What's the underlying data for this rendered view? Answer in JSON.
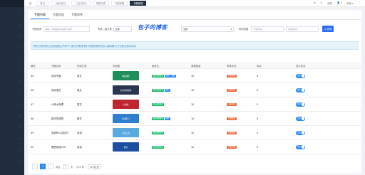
{
  "sidebar": {
    "arrows": [
      "›",
      "›",
      "›",
      "›",
      "›",
      "›",
      "›",
      "›",
      "›",
      "›",
      "›",
      "›",
      "›",
      "›"
    ]
  },
  "topbar": {
    "tabs": [
      "首",
      "首页",
      "一级分类分",
      "二级分类分",
      "课程列表",
      "专题管理",
      "专题管理"
    ],
    "active_tab": 6,
    "right": [
      "⊞",
      "⚲",
      "全屏",
      "👤 ▾",
      "系统 ▾",
      "⋮"
    ]
  },
  "subtabs": [
    "专题列表",
    "专题添加",
    "专题排序"
  ],
  "filters": {
    "keyword_label": "专题查询",
    "keyword_placeholder": "请输入专题名称,关键字,编号",
    "category_label": "所属二级分类",
    "category_value": "全部",
    "status_value": "全部",
    "time_label": "时间范围",
    "start_placeholder": "开始时间",
    "end_placeholder": "结束时间",
    "search": "Q 查询"
  },
  "watermark": "包子的博客",
  "notice": "列表[分类名称],[是否隐藏],[所有专] 按住可拖拽排序 页面或者修改进入编辑模式,失去焦点保存自动",
  "table": {
    "headers": [
      "编号",
      "专题名称",
      "所属分类",
      "封面图",
      "推荐位",
      "课程数量",
      "审核状态",
      "库存",
      "显示状态"
    ],
    "rows": [
      {
        "id": "45",
        "name": "测试专题",
        "cat": "语文",
        "thumb": "精品课程",
        "tags": [
          "精品课程推荐",
          "推荐",
          "品牌"
        ],
        "count": "10",
        "status": "审核通过",
        "stock": "0",
        "show": "显示",
        "color": "#1e8f5a"
      },
      {
        "id": "46",
        "name": "测试语文",
        "cat": "语文",
        "thumb": "名师金牌课程",
        "tags": [
          "精品课程推荐",
          "推荐"
        ],
        "count": "10",
        "status": "审核通过",
        "stock": "0",
        "show": "显示",
        "color": "#2a3552"
      },
      {
        "id": "47",
        "name": "公考大咖课",
        "cat": "语文",
        "thumb": "大咖课",
        "tags": [
          "精品课程推荐"
        ],
        "count": "10",
        "status": "审核通过",
        "stock": "0",
        "show": "显示",
        "color": "#c0242e"
      },
      {
        "id": "48",
        "name": "数学的逻辑",
        "cat": "数学",
        "thumb": "新课程 4",
        "tags": [
          "精品课程推荐",
          "推荐"
        ],
        "count": "10",
        "status": "审核通过",
        "stock": "0",
        "show": "显示",
        "color": "#2f7ecf"
      },
      {
        "id": "49",
        "name": "英语听口讲技巧",
        "cat": "英语",
        "thumb": "英语口语",
        "tags": [
          "精品课程推荐"
        ],
        "count": "10",
        "status": "审核通过",
        "stock": "0",
        "show": "显示",
        "color": "#5aa9e0"
      },
      {
        "id": "50",
        "name": "雅思英语550",
        "cat": "英语",
        "thumb": "雅思",
        "tags": [
          "精品课程推荐"
        ],
        "count": "10",
        "status": "审核通过",
        "stock": "0",
        "show": "显示",
        "color": "#1b4fa0"
      }
    ]
  },
  "pager": {
    "prev": "‹",
    "pages": [
      "1"
    ],
    "next": "›",
    "goto_label": "前往",
    "goto_value": "1",
    "page_unit": "页",
    "total": "共 6 条",
    "size": "20 条/页"
  }
}
